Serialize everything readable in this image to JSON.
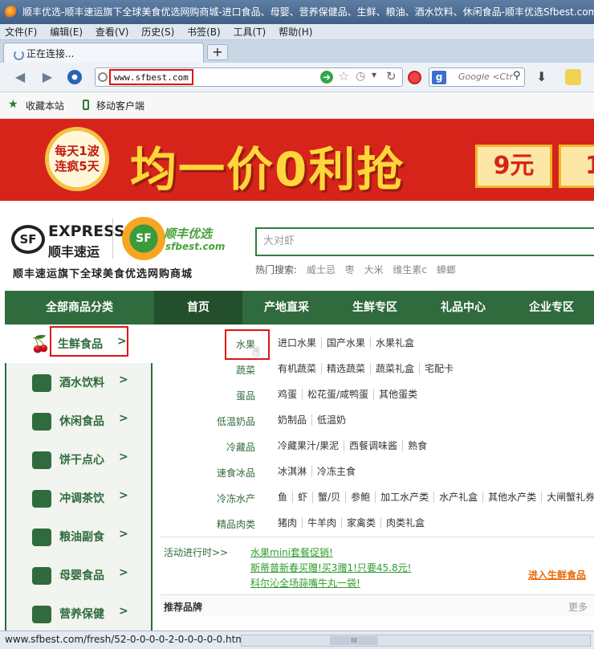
{
  "window": {
    "title": "顺丰优选-顺丰速运旗下全球美食优选网购商城-进口食品、母婴、营养保健品、生鲜、粮油、酒水饮料、休闲食品-顺丰优选Sfbest.com -"
  },
  "menu": [
    "文件(F)",
    "编辑(E)",
    "查看(V)",
    "历史(S)",
    "书签(B)",
    "工具(T)",
    "帮助(H)"
  ],
  "tab": {
    "title": "正在连接...",
    "new_tab": "+"
  },
  "address": {
    "url": "www.sfbest.com"
  },
  "search_engine": {
    "placeholder": "Google <Ctr",
    "icon_letter": "g"
  },
  "bookmarks": {
    "favorite": "收藏本站",
    "mobile": "移动客户端"
  },
  "banner": {
    "circle_line1": "每天1波",
    "circle_line2": "连疯5天",
    "headline": "均一价0利抢",
    "coupon1": "9元",
    "coupon2": "1"
  },
  "logo": {
    "sf": "SF",
    "express": "EXPRESS",
    "express_cn": "顺丰速运",
    "sfbest_cn": "顺丰优选",
    "sfbest_web": "sfbest.com",
    "slogan": "顺丰速运旗下全球美食优选网购商城"
  },
  "site_search": {
    "placeholder": "大对虾",
    "hot_label": "热门搜索:",
    "hot_terms": [
      "威士忌",
      "枣",
      "大米",
      "维生素c",
      "蟑螂"
    ]
  },
  "nav": {
    "all": "全部商品分类",
    "items": [
      "首页",
      "产地直采",
      "生鲜专区",
      "礼品中心",
      "企业专区"
    ]
  },
  "sidebar": [
    {
      "label": "生鲜食品",
      "arrow": ">"
    },
    {
      "label": "酒水饮料",
      "arrow": ">"
    },
    {
      "label": "休闲食品",
      "arrow": ">"
    },
    {
      "label": "饼干点心",
      "arrow": ">"
    },
    {
      "label": "冲调茶饮",
      "arrow": ">"
    },
    {
      "label": "粮油副食",
      "arrow": ">"
    },
    {
      "label": "母婴食品",
      "arrow": ">"
    },
    {
      "label": "营养保健",
      "arrow": ">"
    }
  ],
  "categories": [
    {
      "name": "水果",
      "subs": [
        "进口水果",
        "国产水果",
        "水果礼盒"
      ]
    },
    {
      "name": "蔬菜",
      "subs": [
        "有机蔬菜",
        "精选蔬菜",
        "蔬菜礼盒",
        "宅配卡"
      ]
    },
    {
      "name": "蛋品",
      "subs": [
        "鸡蛋",
        "松花蛋/咸鸭蛋",
        "其他蛋类"
      ]
    },
    {
      "name": "低温奶品",
      "subs": [
        "奶制品",
        "低温奶"
      ]
    },
    {
      "name": "冷藏品",
      "subs": [
        "冷藏果汁/果泥",
        "西餐调味酱",
        "熟食"
      ]
    },
    {
      "name": "速食冰品",
      "subs": [
        "冰淇淋",
        "冷冻主食"
      ]
    },
    {
      "name": "冷冻水产",
      "subs": [
        "鱼",
        "虾",
        "蟹/贝",
        "参鲍",
        "加工水产类",
        "水产礼盒",
        "其他水产类",
        "大闸蟹礼券"
      ]
    },
    {
      "name": "精品肉类",
      "subs": [
        "猪肉",
        "牛羊肉",
        "家禽类",
        "肉类礼盒"
      ]
    }
  ],
  "activity": {
    "label": "活动进行时>>",
    "links": [
      "水果mini套餐促销!",
      "斯蒂普新春买赠!买3赠1!只要45.8元!",
      "科尔沁全场蒜嘴牛丸一袋!"
    ],
    "enter": "进入生鲜食品"
  },
  "recommend": {
    "title": "推荐品牌",
    "more": "更多"
  },
  "status": {
    "url": "www.sfbest.com/fresh/52-0-0-0-0-2-0-0-0-0-0.html",
    "scroll": "III"
  },
  "colors": {
    "brand_green": "#2f6b3d",
    "banner_red": "#d6241b",
    "highlight": "#e01414"
  }
}
